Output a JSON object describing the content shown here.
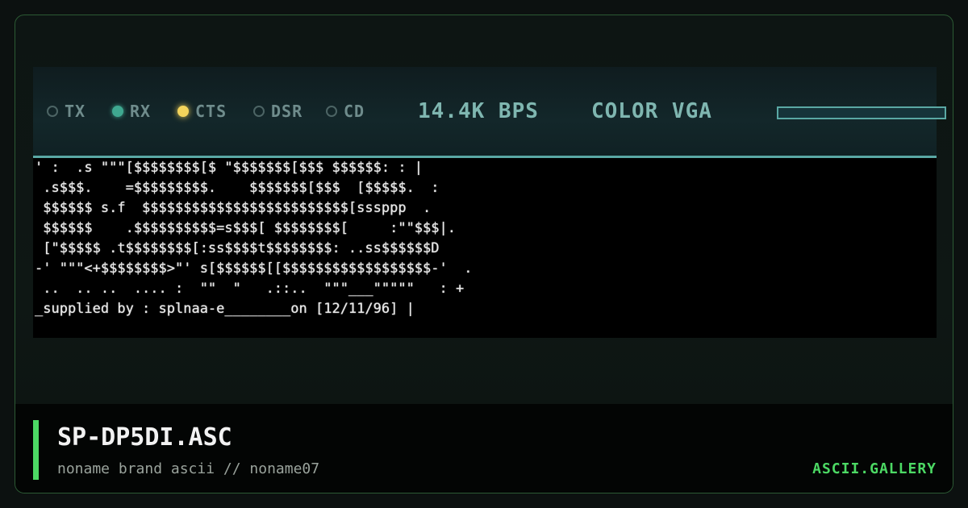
{
  "status": {
    "indicators": [
      {
        "label": "TX",
        "state": "off"
      },
      {
        "label": "RX",
        "state": "on",
        "color": "#3fa890"
      },
      {
        "label": "CTS",
        "state": "on",
        "color": "#f3d45c"
      },
      {
        "label": "DSR",
        "state": "off"
      },
      {
        "label": "CD",
        "state": "off"
      }
    ],
    "baud": "14.4K BPS",
    "mode": "COLOR VGA"
  },
  "art": {
    "lines": [
      "' :  .s \"\"\"[$$$$$$$$[$ \"$$$$$$$[$$$ $$$$$$: : |",
      " .s$$$.    =$$$$$$$$$.    $$$$$$$[$$$  [$$$$$.  :",
      " $$$$$$ s.f  $$$$$$$$$$$$$$$$$$$$$$$$$[sssppp  .",
      " $$$$$$    .$$$$$$$$$$=s$$$[ $$$$$$$$[     :\"\"$$$|.",
      " [\"$$$$$ .t$$$$$$$$[:ss$$$$t$$$$$$$$: ..ss$$$$$$D",
      "-' \"\"\"<+$$$$$$$$>\"' s[$$$$$$[[$$$$$$$$$$$$$$$$$$-'  .",
      " ..  .. ..  .... :  \"\"  \"   .::..  \"\"\"___\"\"\"\"\"   : +",
      "_supplied by : splnaa-e________on [12/11/96] |"
    ]
  },
  "footer": {
    "title": "SP-DP5DI.ASC",
    "subtitle": "noname brand ascii // noname07",
    "brand": "ASCII.GALLERY"
  },
  "colors": {
    "accent": "#4cd964",
    "screen_teal": "#5aa8a4"
  }
}
